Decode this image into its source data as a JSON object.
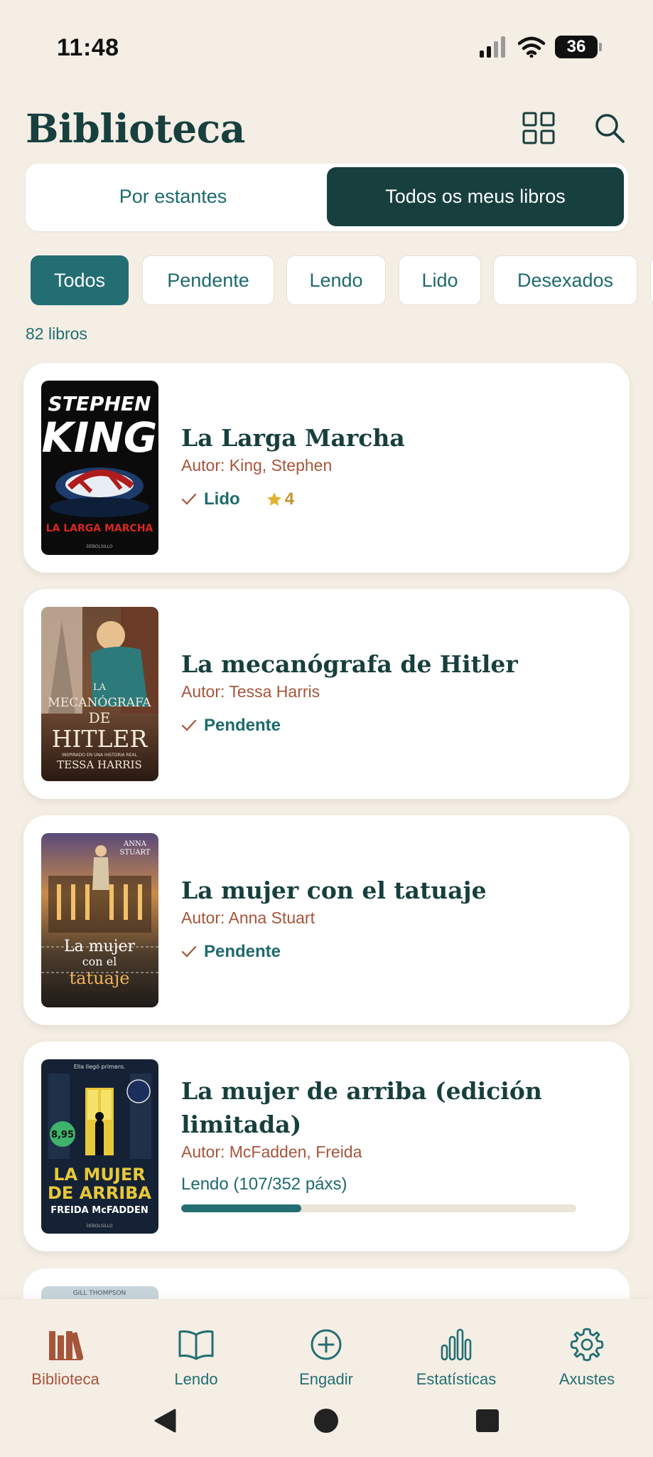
{
  "status_bar": {
    "time": "11:48",
    "battery": "36"
  },
  "header": {
    "title": "Biblioteca"
  },
  "view_toggle": {
    "by_shelves": "Por estantes",
    "all_books": "Todos os meus libros"
  },
  "filters": [
    "Todos",
    "Pendente",
    "Lendo",
    "Lido",
    "Desexados"
  ],
  "book_count": "82 libros",
  "books": [
    {
      "title": "La Larga Marcha",
      "author": "Autor: King, Stephen",
      "status": "Lido",
      "rating": "4",
      "cover": {
        "line1": "STEPHEN",
        "line2": "KING",
        "line3": "LA LARGA MARCHA",
        "publisher": "DEBOLSILLO"
      }
    },
    {
      "title": "La mecanógrafa de Hitler",
      "author": "Autor: Tessa Harris",
      "status": "Pendente",
      "cover": {
        "line1": "LA",
        "line2": "MECANÓGRAFA",
        "line3": "DE",
        "line4": "HITLER",
        "tagline": "INSPIRADO EN UNA HISTORIA REAL",
        "author": "TESSA HARRIS"
      }
    },
    {
      "title": "La mujer con el tatuaje",
      "author": "Autor: Anna Stuart",
      "status": "Pendente",
      "cover": {
        "author_line1": "ANNA",
        "author_line2": "STUART",
        "line1": "La mujer",
        "line2": "con el",
        "line3": "tatuaje"
      }
    },
    {
      "title_line1": "La mujer de arriba (edición",
      "title_line2": "limitada)",
      "author": "Autor: McFadden, Freida",
      "progress_label": "Lendo (107/352 páxs)",
      "progress": 0.304,
      "cover": {
        "tag": "Ella llegó primero.",
        "price": "8,95",
        "line1": "LA MUJER",
        "line2": "DE ARRIBA",
        "line3": "FREIDA McFADDEN",
        "publisher": "DEBOLSILLO"
      }
    }
  ],
  "partial_cover_text": "GILL THOMPSON",
  "bottom_nav": [
    {
      "label": "Biblioteca",
      "icon": "books-icon",
      "active": true
    },
    {
      "label": "Lendo",
      "icon": "open-book-icon",
      "active": false
    },
    {
      "label": "Engadir",
      "icon": "plus-circle-icon",
      "active": false
    },
    {
      "label": "Estatísticas",
      "icon": "bar-chart-icon",
      "active": false
    },
    {
      "label": "Axustes",
      "icon": "gear-icon",
      "active": false
    }
  ],
  "colors": {
    "background": "#F4EEE5",
    "primary_dark": "#173F3E",
    "teal": "#236E72",
    "author_accent": "#A6553A",
    "star": "#E4B12F"
  }
}
